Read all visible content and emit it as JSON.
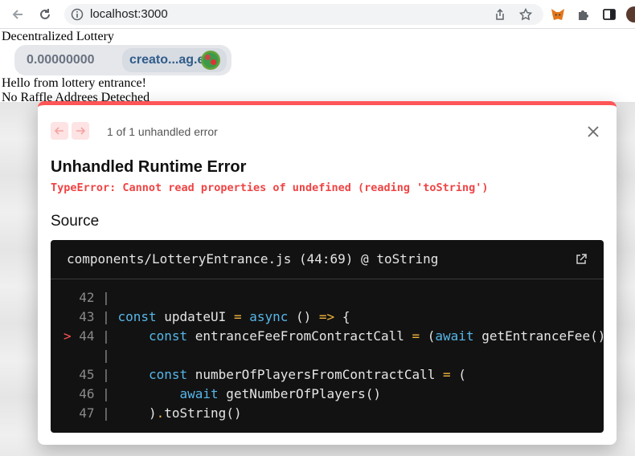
{
  "browser": {
    "url": "localhost:3000"
  },
  "page": {
    "title": "Decentralized Lottery",
    "balance": "0.00000000",
    "account_name": "creato...ag.eth",
    "hello_text": "Hello from lottery entrance!",
    "status_text": "No Raffle Addrees Deteched"
  },
  "error_dialog": {
    "count_text": "1 of 1 unhandled error",
    "title": "Unhandled Runtime Error",
    "message": "TypeError: Cannot read properties of undefined (reading 'toString')",
    "source_heading": "Source",
    "file_ref": "components/LotteryEntrance.js (44:69) @ toString",
    "code_lines": [
      {
        "marker": " ",
        "num": "42",
        "sep": " | ",
        "code": ""
      },
      {
        "marker": " ",
        "num": "43",
        "sep": " | ",
        "code": "const updateUI = async () => {"
      },
      {
        "marker": ">",
        "num": "44",
        "sep": " | ",
        "code": "    const entranceFeeFromContractCall = (await getEntranceFee()"
      },
      {
        "marker": " ",
        "num": "  ",
        "sep": " | ",
        "code": ""
      },
      {
        "marker": " ",
        "num": "45",
        "sep": " | ",
        "code": "    const numberOfPlayersFromContractCall = ("
      },
      {
        "marker": " ",
        "num": "46",
        "sep": " | ",
        "code": "        await getNumberOfPlayers()"
      },
      {
        "marker": " ",
        "num": "47",
        "sep": " | ",
        "code": "    ).toString()"
      }
    ]
  },
  "colors": {
    "error_red": "#ff5555",
    "keyword_blue": "#56b6e8",
    "operator_yellow": "#f0b43c"
  },
  "icons": {
    "back": "arrow-left-icon",
    "reload": "reload-icon",
    "info": "info-icon",
    "share": "share-icon",
    "bookmark": "star-icon",
    "metamask": "fox-icon",
    "extensions": "puzzle-icon",
    "sidepanel": "side-panel-icon",
    "close": "close-icon",
    "external": "external-link-icon"
  }
}
